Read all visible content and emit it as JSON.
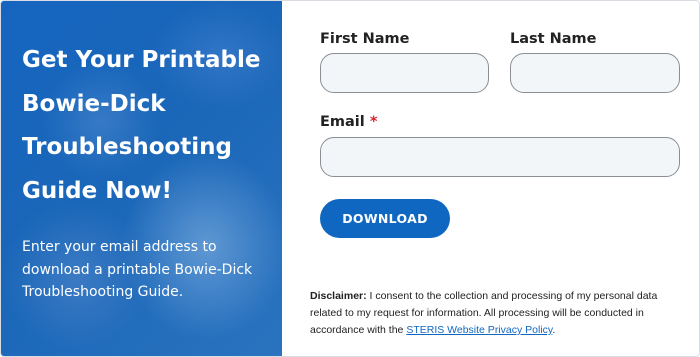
{
  "promo": {
    "title": "Get Your Printable Bowie-Dick Troubleshooting Guide Now!",
    "text": "Enter your email address to download a printable Bowie-Dick Troubleshooting Guide."
  },
  "form": {
    "first_name_label": "First Name",
    "last_name_label": "Last Name",
    "email_label": "Email",
    "required_mark": "*",
    "first_name_value": "",
    "last_name_value": "",
    "email_value": "",
    "download_label": "DOWNLOAD"
  },
  "disclaimer": {
    "label": "Disclaimer:",
    "text": " I consent to the collection and processing of my personal data related to my request for information. All processing will be conducted in accordance with the ",
    "link_text": "STERIS Website Privacy Policy",
    "end": "."
  },
  "colors": {
    "brand_blue": "#0f67c2",
    "required_red": "#d9232d"
  }
}
